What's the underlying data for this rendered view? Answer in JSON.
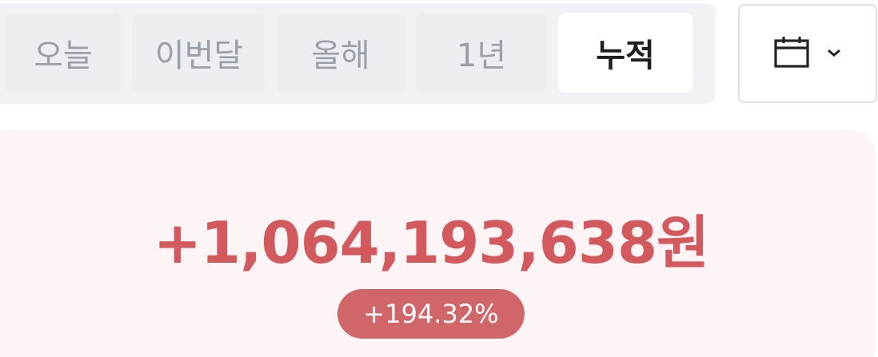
{
  "period_tabs": {
    "items": [
      {
        "label": "오늘"
      },
      {
        "label": "이번달"
      },
      {
        "label": "올해"
      },
      {
        "label": "1년"
      },
      {
        "label": "누적"
      }
    ],
    "selected": "누적"
  },
  "calendar_picker": {
    "icon": "calendar-icon",
    "caret_icon": "chevron-down-icon"
  },
  "summary": {
    "amount": "+1,064,193,638원",
    "rate": "+194.32%"
  },
  "colors": {
    "accent": "#d2595e",
    "badge_bg": "#d06669",
    "card_bg": "#fdf5f5",
    "tab_group_bg": "#f0f2f5"
  }
}
